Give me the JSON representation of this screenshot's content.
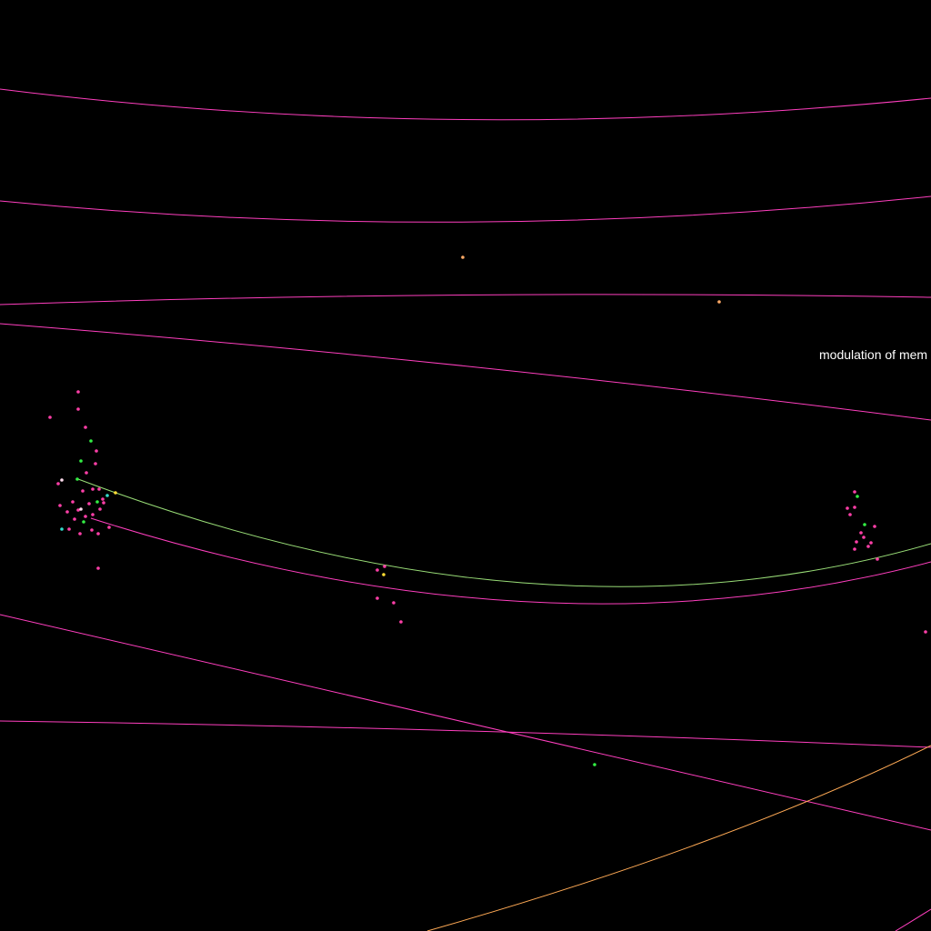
{
  "labels": {
    "visible_label": "modulation of mem"
  },
  "colors": {
    "background": "#000000",
    "edge_pink": "#ff3fbf",
    "edge_orange": "#ffaa55",
    "edge_green": "#99dd77",
    "node_pink": "#ff3fa8",
    "node_green": "#33ee44",
    "node_cyan": "#33ddcc",
    "node_yellow": "#ffdd33",
    "node_orange": "#ffaa66",
    "node_white": "#ffddee"
  }
}
